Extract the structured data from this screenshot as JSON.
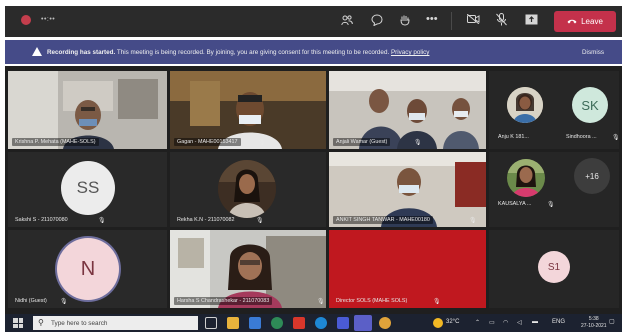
{
  "window": {
    "timer": "••:••",
    "leave_label": "Leave",
    "toolbar_icons": [
      "participants-icon",
      "chat-icon",
      "reactions-icon",
      "more-icon",
      "camera-icon",
      "mic-icon",
      "share-icon"
    ]
  },
  "banner": {
    "title": "Recording has started.",
    "message": "This meeting is being recorded. By joining, you are giving consent for this meeting to be recorded.",
    "link": "Privacy policy",
    "dismiss": "Dismiss"
  },
  "participants": [
    {
      "name": "Krishna P. Mehata (MAHE-SOLS)",
      "kind": "video"
    },
    {
      "name": "Gagan - MAHE00153417",
      "kind": "video"
    },
    {
      "name": "Anjali Wamar (Guest)",
      "kind": "video"
    },
    {
      "name": "Anju K 181...",
      "kind": "photo"
    },
    {
      "name": "Sindhoora ...",
      "kind": "initials",
      "initials": "SK"
    },
    {
      "name": "Sakshi S - 211070080",
      "kind": "initials",
      "initials": "SS"
    },
    {
      "name": "Rekha K.N - 211070082",
      "kind": "photo"
    },
    {
      "name": "ANKIT SINGH TANWAR - MAHE00180",
      "kind": "video"
    },
    {
      "name": "KAUSALYA ...",
      "kind": "photo"
    },
    {
      "name": "Nidhi (Guest)",
      "kind": "initials",
      "initials": "N"
    },
    {
      "name": "Harsha S Chandrashekar - 211070083",
      "kind": "video"
    },
    {
      "name": "Director SOLS (MAHE SOLS)",
      "kind": "video"
    },
    {
      "name": "",
      "kind": "initials",
      "initials": "S1"
    }
  ],
  "overflow_count": "+16",
  "taskbar": {
    "search_placeholder": "Type here to search",
    "temperature": "32°C",
    "language": "ENG",
    "time": "5:38",
    "date": "27-10-2021"
  },
  "colors": {
    "topbar": "#2b2b2b",
    "banner": "#454b88",
    "leave": "#c4314b",
    "grid_bg": "#1f1f1f",
    "tile_bg": "#292929",
    "red_tile": "#c0181f",
    "sk_avatar": "#cfe8dc",
    "ss_avatar": "#ececec",
    "n_avatar": "#f3d6da",
    "s1_avatar": "#f3d6da"
  }
}
